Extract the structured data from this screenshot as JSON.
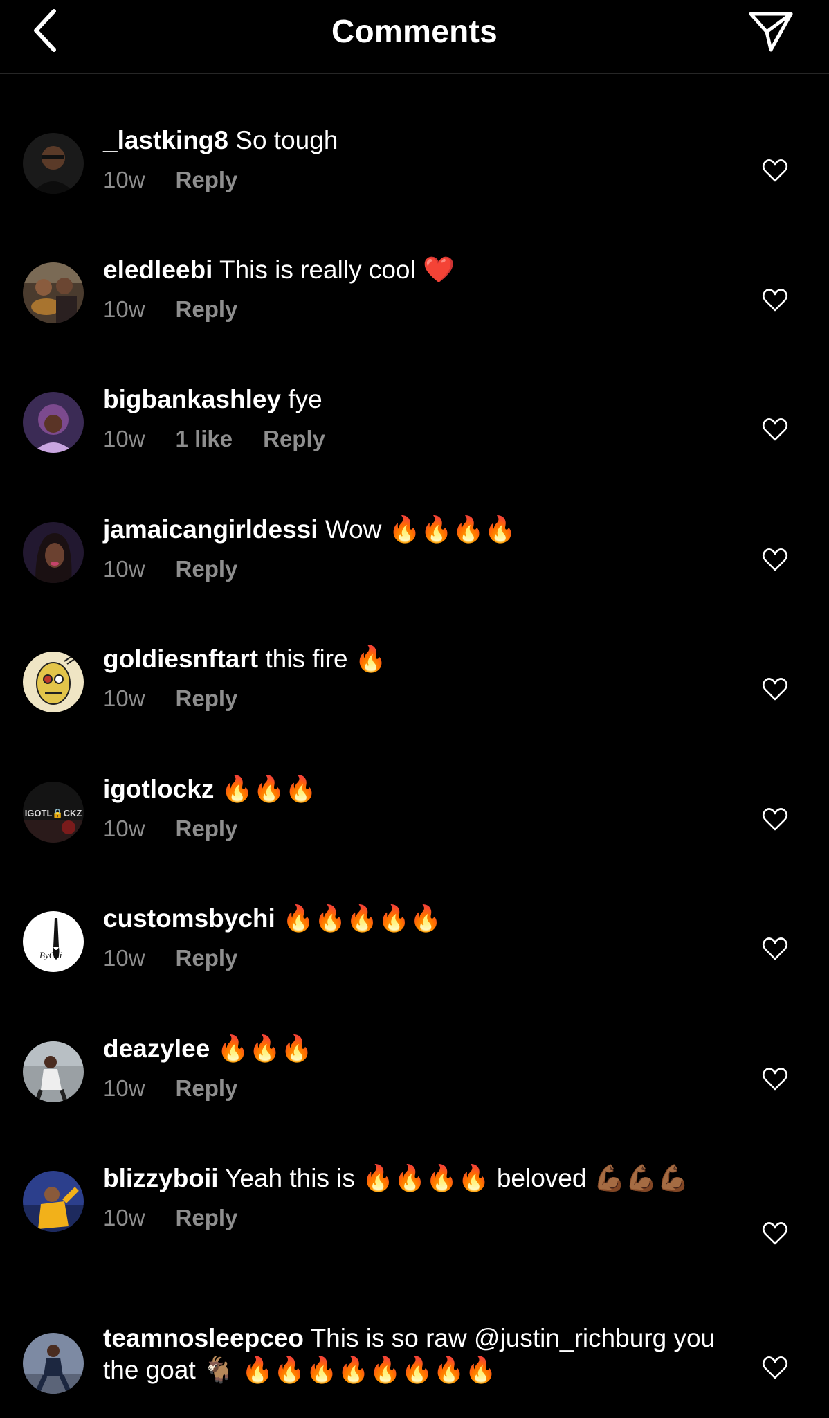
{
  "header": {
    "title": "Comments",
    "back_icon": "chevron-left-icon",
    "send_icon": "paper-plane-icon"
  },
  "colors": {
    "background": "#000000",
    "text": "#ffffff",
    "secondary_text": "#8e8e8e",
    "divider": "#262626"
  },
  "comments": [
    {
      "username": "_lastking8",
      "text": " So tough",
      "time": "10w",
      "likes": "",
      "reply": "Reply"
    },
    {
      "username": "eledleebi",
      "text": " This is really cool ❤️",
      "time": "10w",
      "likes": "",
      "reply": "Reply"
    },
    {
      "username": "bigbankashley",
      "text": " fye",
      "time": "10w",
      "likes": "1 like",
      "reply": "Reply"
    },
    {
      "username": "jamaicangirldessi",
      "text": " Wow 🔥🔥🔥🔥",
      "time": "10w",
      "likes": "",
      "reply": "Reply"
    },
    {
      "username": "goldiesnftart",
      "text": " this fire 🔥",
      "time": "10w",
      "likes": "",
      "reply": "Reply"
    },
    {
      "username": "igotlockz",
      "text": " 🔥🔥🔥",
      "time": "10w",
      "likes": "",
      "reply": "Reply"
    },
    {
      "username": "customsbychi",
      "text": " 🔥🔥🔥🔥🔥",
      "time": "10w",
      "likes": "",
      "reply": "Reply"
    },
    {
      "username": "deazylee",
      "text": " 🔥🔥🔥",
      "time": "10w",
      "likes": "",
      "reply": "Reply"
    },
    {
      "username": "blizzyboii",
      "text": " Yeah this is 🔥🔥🔥🔥 beloved 💪🏾💪🏾💪🏾",
      "time": "10w",
      "likes": "",
      "reply": "Reply"
    },
    {
      "username": "teamnosleepceo",
      "text": " This is so raw @justin_richburg you the goat 🐐 🔥🔥🔥🔥🔥🔥🔥🔥",
      "time": "",
      "likes": "",
      "reply": ""
    }
  ],
  "avatar_labels": {
    "igotlockz": "IGOTLOCKZ",
    "customsbychi": "ByChi"
  }
}
